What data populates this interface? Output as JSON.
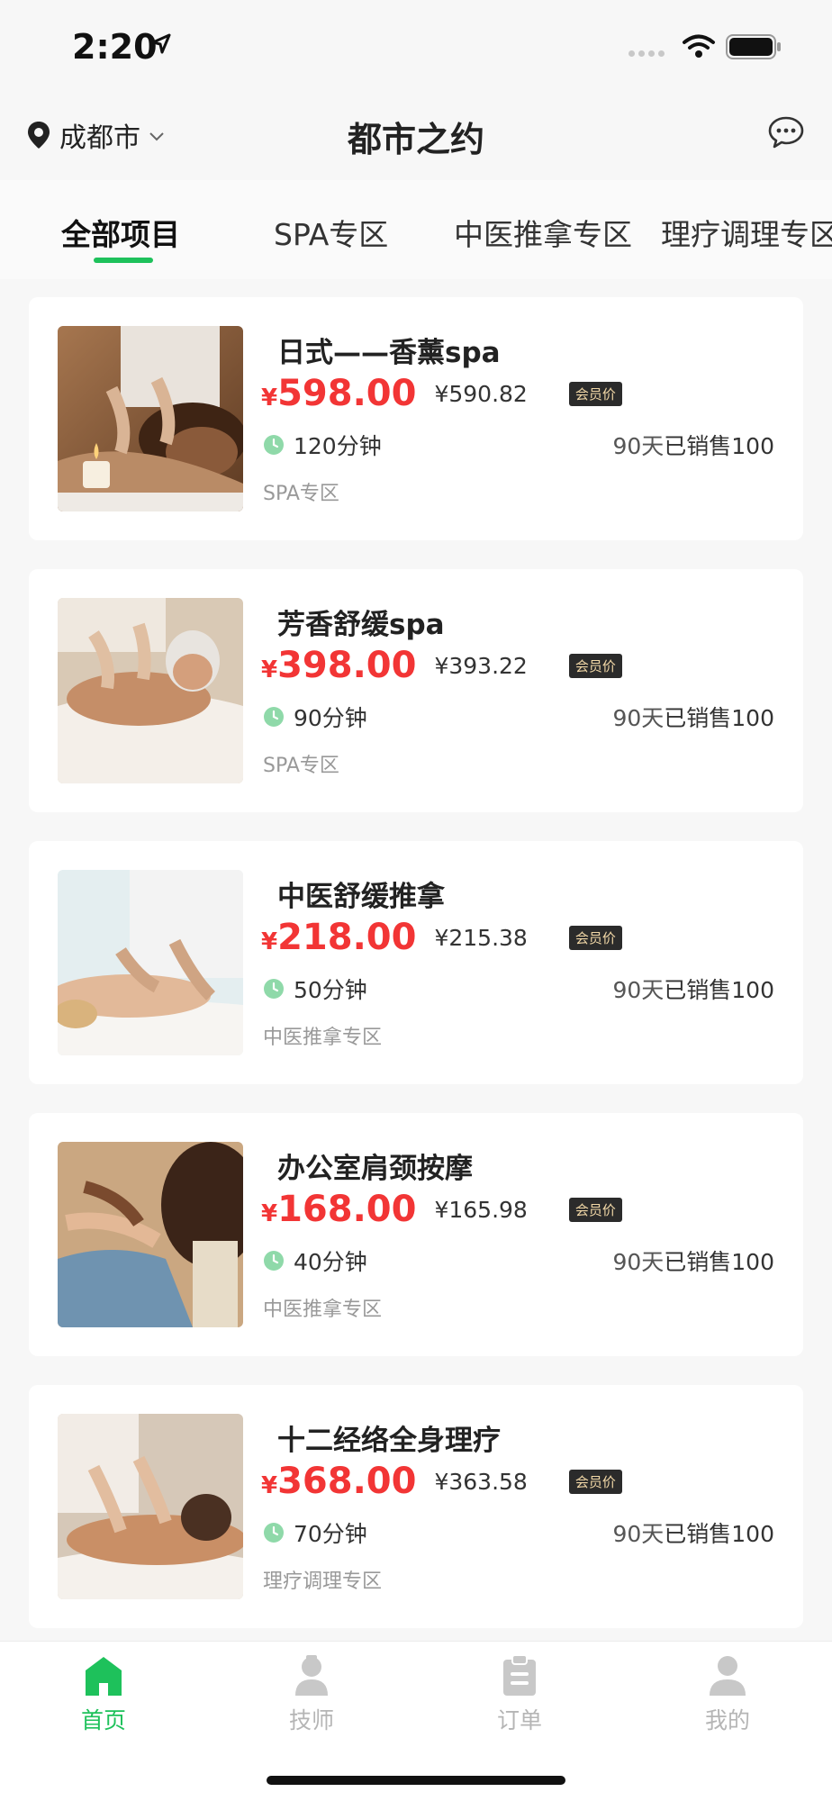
{
  "status_bar": {
    "time": "2:20"
  },
  "header": {
    "city": "成都市",
    "title": "都市之约"
  },
  "tabs": [
    {
      "label": "全部项目",
      "active": true
    },
    {
      "label": "SPA专区",
      "active": false
    },
    {
      "label": "中医推拿专区",
      "active": false
    },
    {
      "label": "理疗调理专区",
      "active": false
    }
  ],
  "products": [
    {
      "title": "日式——香薰spa",
      "currency": "¥",
      "price": "598.00",
      "member_price": "¥590.82",
      "member_tag": "会员价",
      "duration": "120分钟",
      "sales_days": "90天",
      "sales_text": "已销售100",
      "category": "SPA专区"
    },
    {
      "title": "芳香舒缓spa",
      "currency": "¥",
      "price": "398.00",
      "member_price": "¥393.22",
      "member_tag": "会员价",
      "duration": "90分钟",
      "sales_days": "90天",
      "sales_text": "已销售100",
      "category": "SPA专区"
    },
    {
      "title": "中医舒缓推拿",
      "currency": "¥",
      "price": "218.00",
      "member_price": "¥215.38",
      "member_tag": "会员价",
      "duration": "50分钟",
      "sales_days": "90天",
      "sales_text": "已销售100",
      "category": "中医推拿专区"
    },
    {
      "title": "办公室肩颈按摩",
      "currency": "¥",
      "price": "168.00",
      "member_price": "¥165.98",
      "member_tag": "会员价",
      "duration": "40分钟",
      "sales_days": "90天",
      "sales_text": "已销售100",
      "category": "中医推拿专区"
    },
    {
      "title": "十二经络全身理疗",
      "currency": "¥",
      "price": "368.00",
      "member_price": "¥363.58",
      "member_tag": "会员价",
      "duration": "70分钟",
      "sales_days": "90天",
      "sales_text": "已销售100",
      "category": "理疗调理专区"
    }
  ],
  "bottom_tabs": [
    {
      "label": "首页",
      "icon": "home-icon",
      "active": true
    },
    {
      "label": "技师",
      "icon": "technician-icon",
      "active": false
    },
    {
      "label": "订单",
      "icon": "clipboard-icon",
      "active": false
    },
    {
      "label": "我的",
      "icon": "user-icon",
      "active": false
    }
  ],
  "colors": {
    "accent": "#1ec15b",
    "price": "#f23535",
    "member_tag_bg": "#2b2b2b",
    "member_tag_text": "#f2d8a7"
  }
}
